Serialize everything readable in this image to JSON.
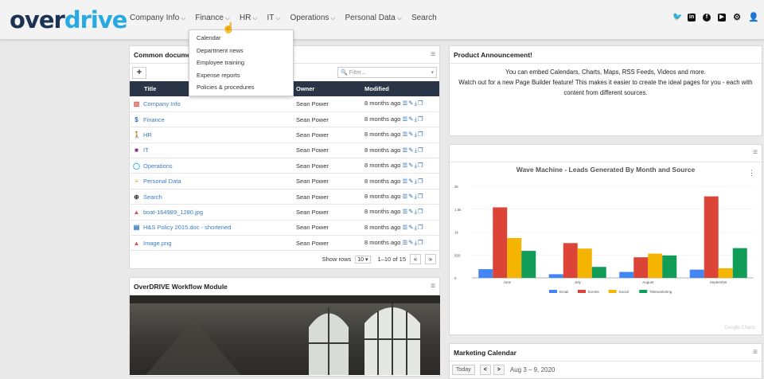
{
  "brand": {
    "logo_main": "over",
    "logo_accent": "drive"
  },
  "nav": [
    {
      "label": "Company Info",
      "has_menu": true
    },
    {
      "label": "Finance",
      "has_menu": true
    },
    {
      "label": "HR",
      "has_menu": true
    },
    {
      "label": "IT",
      "has_menu": true
    },
    {
      "label": "Operations",
      "has_menu": true
    },
    {
      "label": "Personal Data",
      "has_menu": true
    },
    {
      "label": "Search",
      "has_menu": false
    }
  ],
  "finance_menu": [
    "Calendar",
    "Department news",
    "Employee training",
    "Expense reports",
    "Policies & procedures"
  ],
  "social_icons": [
    "twitter-icon",
    "linkedin-icon",
    "facebook-icon",
    "youtube-icon",
    "gear-icon",
    "user-icon"
  ],
  "documents": {
    "title": "Common documents",
    "filter_placeholder": "Filter...",
    "add_label": "+",
    "columns": {
      "title": "Title",
      "owner": "Owner",
      "modified": "Modified"
    },
    "rows": [
      {
        "icon": "building-icon",
        "icon_color": "#d9534f",
        "title": "Company Info",
        "owner": "Sean Power",
        "modified": "8 months ago"
      },
      {
        "icon": "dollar-icon",
        "icon_color": "#2a6ebb",
        "title": "Finance",
        "owner": "Sean Power",
        "modified": "8 months ago"
      },
      {
        "icon": "person-icon",
        "icon_color": "#3aa53a",
        "title": "HR",
        "owner": "Sean Power",
        "modified": "8 months ago"
      },
      {
        "icon": "briefcase-icon",
        "icon_color": "#8e2b8e",
        "title": "IT",
        "owner": "Sean Power",
        "modified": "8 months ago"
      },
      {
        "icon": "circle-icon",
        "icon_color": "#27a9e1",
        "title": "Operations",
        "owner": "Sean Power",
        "modified": "8 months ago"
      },
      {
        "icon": "database-icon",
        "icon_color": "#f0a030",
        "title": "Personal Data",
        "owner": "Sean Power",
        "modified": "8 months ago"
      },
      {
        "icon": "search-icon",
        "icon_color": "#333333",
        "title": "Search",
        "owner": "Sean Power",
        "modified": "8 months ago"
      },
      {
        "icon": "image-icon",
        "icon_color": "#d9534f",
        "title": "boat-164989_1280.jpg",
        "owner": "Sean Power",
        "modified": "8 months ago"
      },
      {
        "icon": "doc-icon",
        "icon_color": "#2a6ebb",
        "title": "H&S Policy 2015.doc - shortened",
        "owner": "Sean Power",
        "modified": "8 months ago"
      },
      {
        "icon": "image-icon",
        "icon_color": "#d9534f",
        "title": "Image.png",
        "owner": "Sean Power",
        "modified": "8 months ago"
      }
    ],
    "show_rows_label": "Show rows",
    "rows_value": "10",
    "range": "1–10 of 15",
    "prev": "«",
    "next": "»"
  },
  "announcement": {
    "title": "Product Announcement!",
    "line1": "You can embed Calendars, Charts, Maps, RSS Feeds, Videos and more.",
    "line2": "Watch out for a new Page Builder feature! This makes it easier to create the ideal pages for you - each with content from different sources."
  },
  "workflow": {
    "title": "OverDRIVE Workflow Module"
  },
  "marketing": {
    "title": "Marketing Calendar",
    "today": "Today",
    "prev": "<",
    "next": ">",
    "range": "Aug 3 – 9, 2020"
  },
  "colors": {
    "email": "#4285f4",
    "events": "#db4437",
    "social": "#f4b400",
    "telemarketing": "#0f9d58"
  },
  "chart_data": {
    "type": "bar",
    "title": "Wave Machine - Leads Generated By Month and Source",
    "categories": [
      "June",
      "July",
      "August",
      "September"
    ],
    "ylim": [
      0,
      2000
    ],
    "yticks": [
      "0",
      "500",
      "1k",
      "1.5k",
      "2k"
    ],
    "series": [
      {
        "name": "Email",
        "color": "#4285f4",
        "values": [
          190,
          80,
          130,
          180
        ]
      },
      {
        "name": "Events",
        "color": "#db4437",
        "values": [
          1540,
          760,
          450,
          1780
        ]
      },
      {
        "name": "Social",
        "color": "#f4b400",
        "values": [
          870,
          640,
          530,
          210
        ]
      },
      {
        "name": "Telemarketing",
        "color": "#0f9d58",
        "values": [
          590,
          240,
          490,
          650
        ]
      }
    ],
    "legend": "bottom",
    "watermark": "Google Charts"
  }
}
